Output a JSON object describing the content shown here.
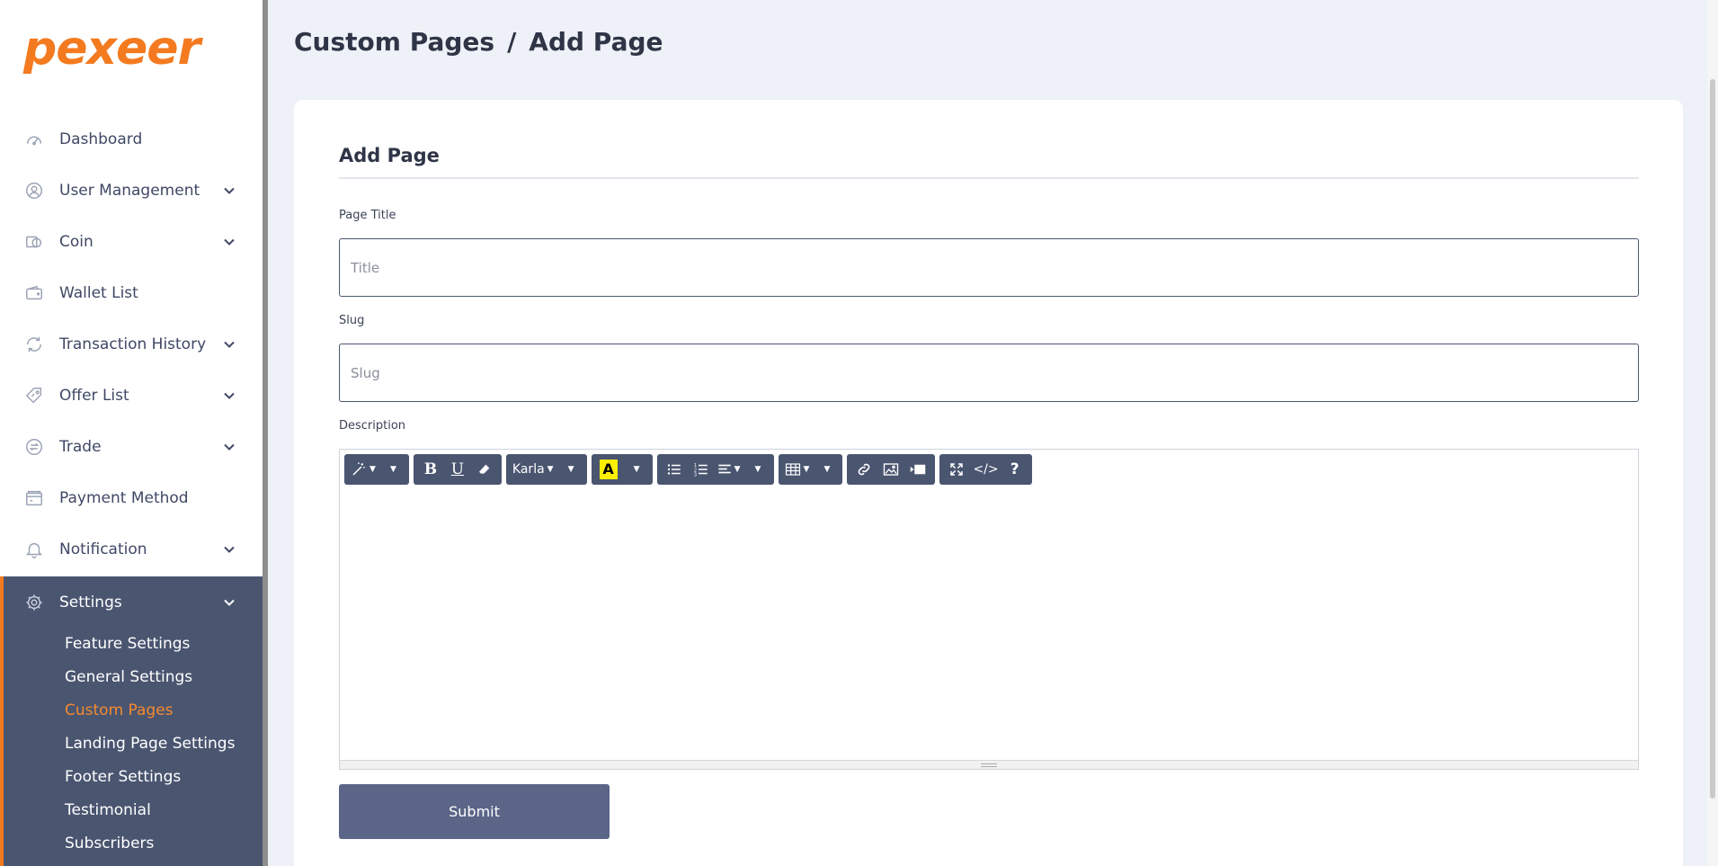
{
  "brand": {
    "logo_text": "pexeer",
    "accent": "#f47a20",
    "sidebar_active_bg": "#4a5570"
  },
  "sidebar": {
    "items": [
      {
        "label": "Dashboard",
        "icon": "speedometer-icon",
        "has_submenu": false
      },
      {
        "label": "User Management",
        "icon": "user-icon",
        "has_submenu": true
      },
      {
        "label": "Coin",
        "icon": "coin-icon",
        "has_submenu": true
      },
      {
        "label": "Wallet List",
        "icon": "wallet-icon",
        "has_submenu": false
      },
      {
        "label": "Transaction History",
        "icon": "transaction-icon",
        "has_submenu": true
      },
      {
        "label": "Offer List",
        "icon": "offer-tag-icon",
        "has_submenu": true
      },
      {
        "label": "Trade",
        "icon": "trade-icon",
        "has_submenu": true
      },
      {
        "label": "Payment Method",
        "icon": "payment-icon",
        "has_submenu": false
      },
      {
        "label": "Notification",
        "icon": "bell-icon",
        "has_submenu": true
      }
    ],
    "settings": {
      "label": "Settings",
      "icon": "gear-icon",
      "submenu": [
        {
          "label": "Feature Settings",
          "active": false
        },
        {
          "label": "General Settings",
          "active": false
        },
        {
          "label": "Custom Pages",
          "active": true
        },
        {
          "label": "Landing Page Settings",
          "active": false
        },
        {
          "label": "Footer Settings",
          "active": false
        },
        {
          "label": "Testimonial",
          "active": false
        },
        {
          "label": "Subscribers",
          "active": false
        }
      ]
    }
  },
  "breadcrumb": {
    "parent": "Custom Pages",
    "separator": "/",
    "current": "Add Page"
  },
  "form": {
    "title": "Add Page",
    "page_title": {
      "label": "Page Title",
      "placeholder": "Title",
      "value": ""
    },
    "slug": {
      "label": "Slug",
      "placeholder": "Slug",
      "value": ""
    },
    "description": {
      "label": "Description",
      "font_select": "Karla",
      "highlight_letter": "A",
      "toolbar_icons": [
        "magic-wand-icon",
        "bold-icon",
        "underline-icon",
        "eraser-icon",
        "font-family-select",
        "highlight-color-icon",
        "unordered-list-icon",
        "ordered-list-icon",
        "align-icon",
        "table-icon",
        "link-icon",
        "picture-icon",
        "video-icon",
        "fullscreen-icon",
        "code-view-icon",
        "help-icon"
      ],
      "code_view_label": "</>",
      "help_label": "?",
      "bold_label": "B",
      "underline_label": "U"
    },
    "submit_label": "Submit"
  }
}
